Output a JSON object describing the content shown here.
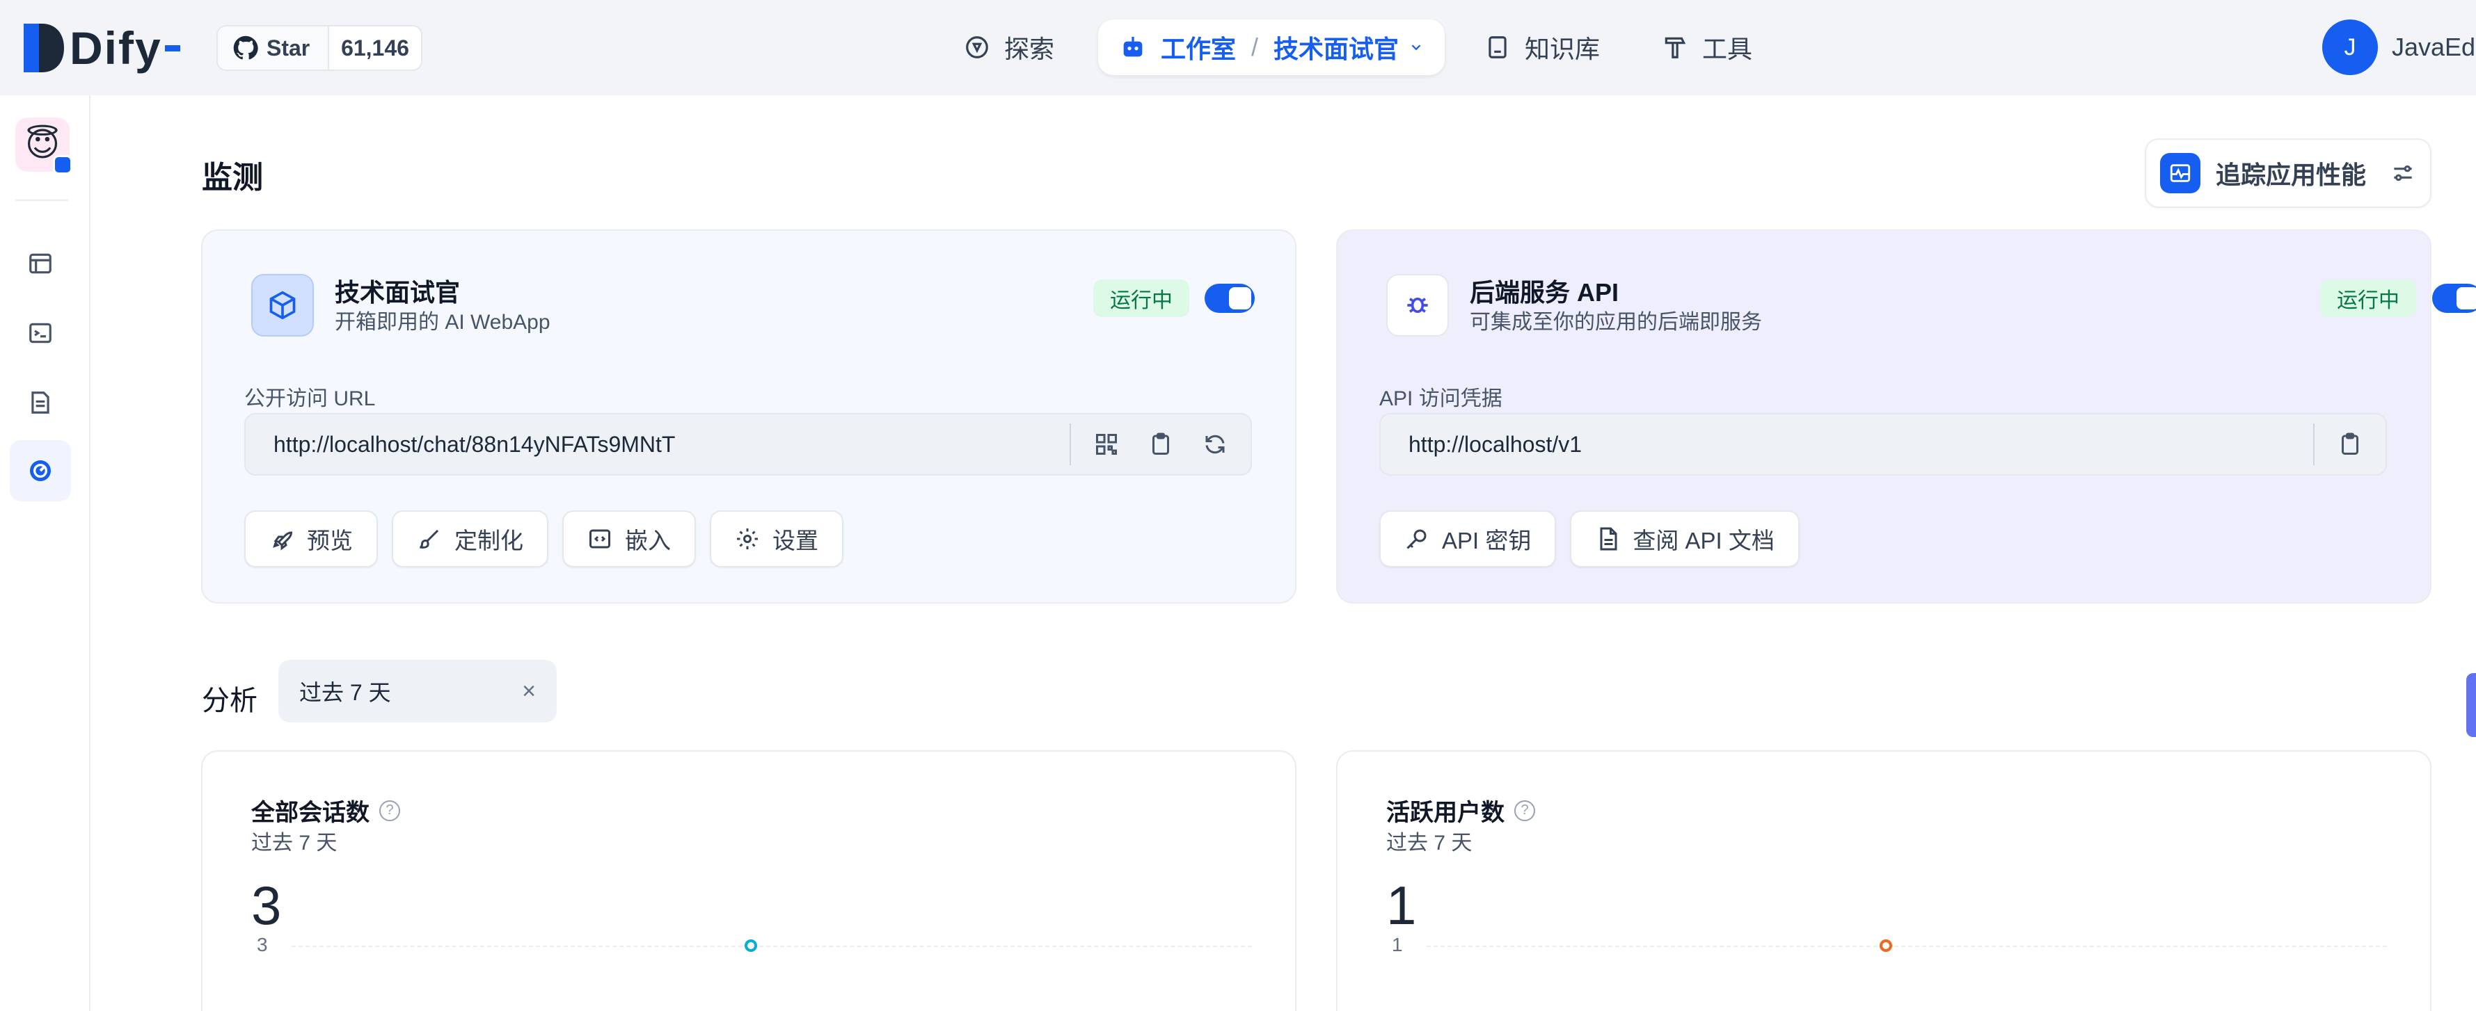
{
  "header": {
    "logo_text": "Dify",
    "github_star_label": "Star",
    "github_star_count": "61,146",
    "nav": {
      "explore": "探索",
      "studio": "工作室",
      "breadcrumb_separator": "/",
      "current_app": "技术面试官",
      "knowledge": "知识库",
      "tools": "工具"
    },
    "user": {
      "avatar_letter": "J",
      "name": "JavaEdge"
    }
  },
  "sidebar": {
    "app_emoji": "😇",
    "items": [
      {
        "icon": "layout-icon"
      },
      {
        "icon": "terminal-icon"
      },
      {
        "icon": "log-icon"
      },
      {
        "icon": "monitor-gauge-icon",
        "active": true
      }
    ]
  },
  "page": {
    "title": "监测",
    "trace_button": "追踪应用性能"
  },
  "webapp_card": {
    "title": "技术面试官",
    "subtitle": "开箱即用的 AI WebApp",
    "status": "运行中",
    "field_label": "公开访问 URL",
    "url": "http://localhost/chat/88n14yNFATs9MNtT",
    "buttons": [
      "预览",
      "定制化",
      "嵌入",
      "设置"
    ]
  },
  "api_card": {
    "title": "后端服务 API",
    "subtitle": "可集成至你的应用的后端即服务",
    "status": "运行中",
    "field_label": "API 访问凭据",
    "url": "http://localhost/v1",
    "buttons": [
      "API 密钥",
      "查阅 API 文档"
    ]
  },
  "analysis": {
    "label": "分析",
    "period": "过去 7 天",
    "close_glyph": "×"
  },
  "metrics": [
    {
      "title": "全部会话数",
      "subtitle": "过去 7 天",
      "value": "3",
      "axis_tick": "3",
      "point_color": "#06aed4"
    },
    {
      "title": "活跃用户数",
      "subtitle": "过去 7 天",
      "value": "1",
      "axis_tick": "1",
      "point_color": "#ef6820"
    }
  ],
  "colors": {
    "primary": "#155eef",
    "status_bg": "#dcfae6",
    "status_text": "#067647"
  }
}
